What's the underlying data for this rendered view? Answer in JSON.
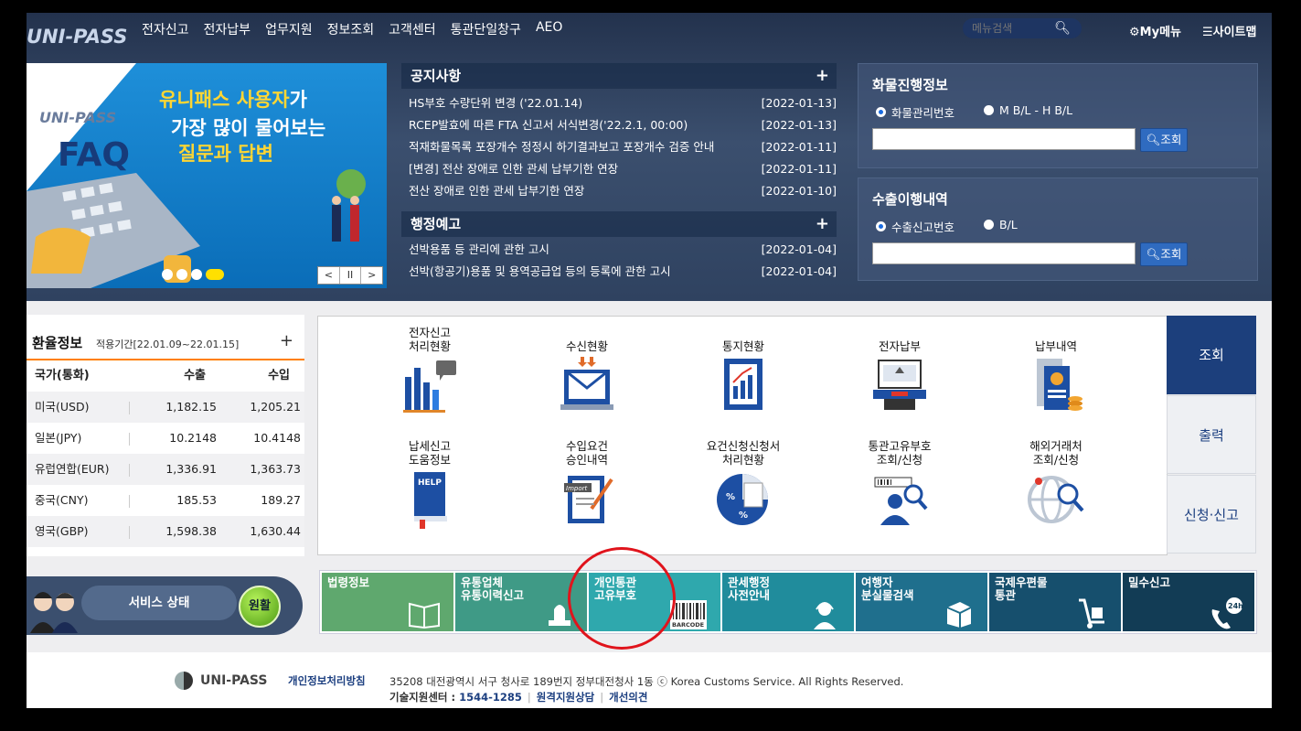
{
  "header": {
    "logo": "UNI-PASS",
    "nav": [
      "전자신고",
      "전자납부",
      "업무지원",
      "정보조회",
      "고객센터",
      "통관단일창구",
      "AEO"
    ],
    "search_placeholder": "메뉴검색",
    "mymenu_label": "My메뉴",
    "sitemap_label": "사이트맵"
  },
  "banner": {
    "line1_highlight": "유니패스 사용자",
    "line1_rest": "가",
    "line2": "가장 많이 물어보는",
    "line3": "질문과 답변",
    "logo": "UNI-PASS",
    "faq": "FAQ",
    "controls": [
      "<",
      "II",
      ">"
    ]
  },
  "notice": {
    "title": "공지사항",
    "more": "+",
    "items": [
      {
        "title": "HS부호 수량단위 변경 ('22.01.14)",
        "date": "[2022-01-13]"
      },
      {
        "title": "RCEP발효에 따른 FTA 신고서 서식변경('22.2.1, 00:00)",
        "date": "[2022-01-13]"
      },
      {
        "title": "적재화물목록 포장개수 정정시 하기결과보고 포장개수 검증 안내",
        "date": "[2022-01-11]"
      },
      {
        "title": "[변경] 전산 장애로 인한 관세 납부기한 연장",
        "date": "[2022-01-11]"
      },
      {
        "title": "전산 장애로 인한 관세 납부기한 연장",
        "date": "[2022-01-10]"
      }
    ]
  },
  "admin_notice": {
    "title": "행정예고",
    "more": "+",
    "items": [
      {
        "title": "선박용품 등 관리에 관한 고시",
        "date": "[2022-01-04]"
      },
      {
        "title": "선박(항공기)용품 및 용역공급업 등의 등록에 관한 고시",
        "date": "[2022-01-04]"
      }
    ]
  },
  "cargo": {
    "title": "화물진행정보",
    "opt1": "화물관리번호",
    "opt2": "M B/L - H B/L",
    "button": "조회"
  },
  "export": {
    "title": "수출이행내역",
    "opt1": "수출신고번호",
    "opt2": "B/L",
    "button": "조회"
  },
  "exchange": {
    "title": "환율정보",
    "period": "적용기간[22.01.09~22.01.15]",
    "more": "+",
    "headers": [
      "국가(통화)",
      "수출",
      "수입"
    ],
    "rows": [
      {
        "country": "미국(USD)",
        "export": "1,182.15",
        "import": "1,205.21"
      },
      {
        "country": "일본(JPY)",
        "export": "10.2148",
        "import": "10.4148"
      },
      {
        "country": "유럽연합(EUR)",
        "export": "1,336.91",
        "import": "1,363.73"
      },
      {
        "country": "중국(CNY)",
        "export": "185.53",
        "import": "189.27"
      },
      {
        "country": "영국(GBP)",
        "export": "1,598.38",
        "import": "1,630.44"
      }
    ]
  },
  "services": {
    "row1": [
      {
        "l1": "전자신고",
        "l2": "처리현황"
      },
      {
        "l1": "",
        "l2": "수신현황"
      },
      {
        "l1": "",
        "l2": "통지현황"
      },
      {
        "l1": "",
        "l2": "전자납부"
      },
      {
        "l1": "",
        "l2": "납부내역"
      }
    ],
    "row2": [
      {
        "l1": "납세신고",
        "l2": "도움정보"
      },
      {
        "l1": "수입요건",
        "l2": "승인내역"
      },
      {
        "l1": "요건신청신청서",
        "l2": "처리현황"
      },
      {
        "l1": "통관고유부호",
        "l2": "조회/신청"
      },
      {
        "l1": "해외거래처",
        "l2": "조회/신청"
      }
    ],
    "tabs": [
      "조회",
      "출력",
      "신청·신고"
    ]
  },
  "status": {
    "label": "서비스 상태",
    "value": "원활"
  },
  "tiles": [
    {
      "l1": "법령정보",
      "l2": "",
      "color": "#5fa86e"
    },
    {
      "l1": "유통업체",
      "l2": "유통이력신고",
      "color": "#3f9a86"
    },
    {
      "l1": "개인통관",
      "l2": "고유부호",
      "color": "#2fa8ad"
    },
    {
      "l1": "관세행정",
      "l2": "사전안내",
      "color": "#208c9c"
    },
    {
      "l1": "여행자",
      "l2": "분실물검색",
      "color": "#1f6f8d"
    },
    {
      "l1": "국제우편물",
      "l2": "통관",
      "color": "#164f6d"
    },
    {
      "l1": "밀수신고",
      "l2": "",
      "color": "#123c55"
    }
  ],
  "barcode_label": "BARCODE",
  "badge_24h": "24h",
  "footer": {
    "logo": "UNI-PASS",
    "privacy": "개인정보처리방침",
    "address": "35208 대전광역시 서구 청사로 189번지 정부대전청사 1동 ⓒ Korea Customs Service. All Rights Reserved.",
    "tech_label": "기술지원센터 :",
    "phone": "1544-1285",
    "remote": "원격지원상담",
    "opinion": "개선의견"
  }
}
